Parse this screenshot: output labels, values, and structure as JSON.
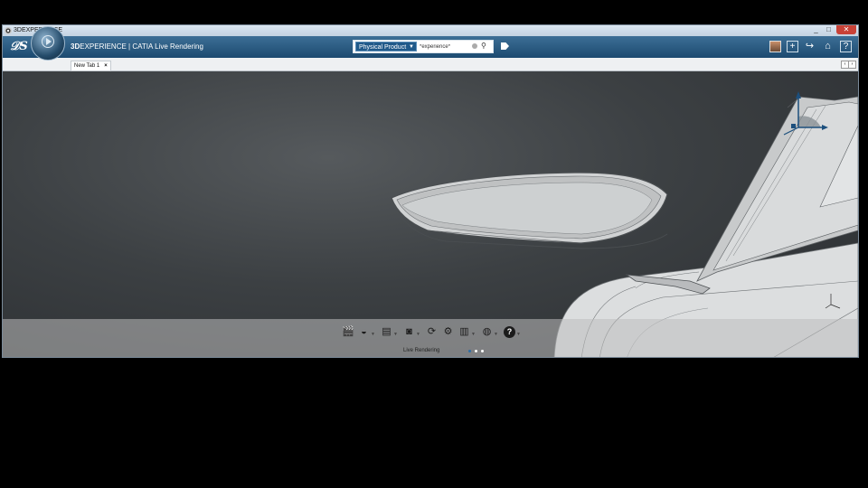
{
  "window": {
    "title": "3DEXPERIENCE",
    "min_label": "_",
    "max_label": "□",
    "close_label": "✕"
  },
  "topbar": {
    "brand_prefix": "3D",
    "brand_main": "EXPERIENCE | CATIA",
    "app_name": "Live Rendering",
    "search": {
      "scope": "Physical Product",
      "value": "*experience*"
    },
    "icons": [
      "user-avatar",
      "plus-icon",
      "share-icon",
      "home-icon",
      "help-icon"
    ]
  },
  "tabs": [
    {
      "label": "New Tab 1",
      "close": "×"
    }
  ],
  "actionbar": {
    "label": "Live Rendering",
    "tools": [
      {
        "name": "clapper-icon",
        "glyph": "🎬"
      },
      {
        "name": "material-sphere-icon",
        "glyph": "◒"
      },
      {
        "name": "environment-icon",
        "glyph": "▤"
      },
      {
        "name": "camera-icon",
        "glyph": "◙"
      },
      {
        "name": "render-icon",
        "glyph": "⟳"
      },
      {
        "name": "settings-gear-icon",
        "glyph": "⚙"
      },
      {
        "name": "library-icon",
        "glyph": "▥"
      },
      {
        "name": "globe-icon",
        "glyph": "◍"
      },
      {
        "name": "help-icon",
        "glyph": "?"
      }
    ],
    "pages": 3,
    "active_page": 1
  },
  "colors": {
    "topbar": "#1c4a70",
    "accent": "#2e6da4",
    "viewport": "#3c4043"
  }
}
